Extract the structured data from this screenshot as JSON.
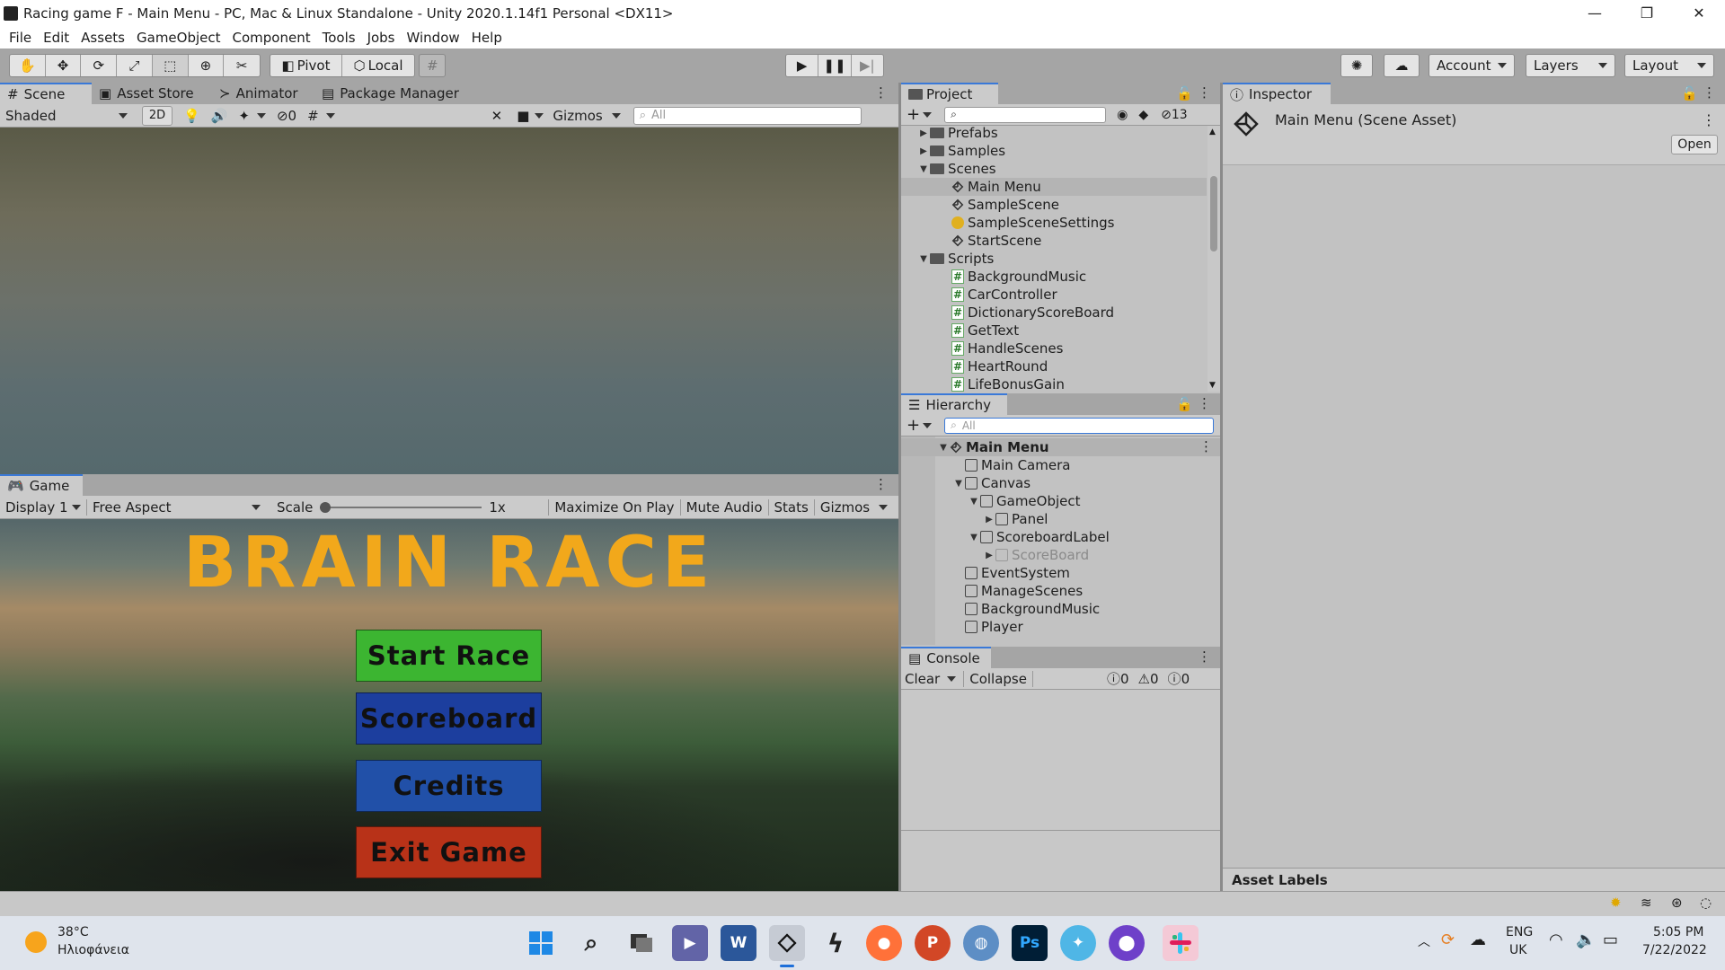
{
  "window": {
    "title": "Racing game F - Main Menu - PC, Mac & Linux Standalone - Unity 2020.1.14f1 Personal <DX11>",
    "controls": [
      "—",
      "❐",
      "✕"
    ]
  },
  "menubar": [
    "File",
    "Edit",
    "Assets",
    "GameObject",
    "Component",
    "Tools",
    "Jobs",
    "Window",
    "Help"
  ],
  "toolbar": {
    "pivot": "Pivot",
    "local": "Local",
    "account": "Account",
    "layers": "Layers",
    "layout": "Layout"
  },
  "scene_panel": {
    "tabs": [
      "Scene",
      "Asset Store",
      "Animator",
      "Package Manager"
    ],
    "shading": "Shaded",
    "mode_2d": "2D",
    "hidden_count": "0",
    "gizmos": "Gizmos",
    "search_placeholder": "All"
  },
  "game_panel": {
    "tab": "Game",
    "display": "Display 1",
    "aspect": "Free Aspect",
    "scale_label": "Scale",
    "scale_value": "1x",
    "buttons": [
      "Maximize On Play",
      "Mute Audio",
      "Stats",
      "Gizmos"
    ],
    "game_title": "BRAIN RACE",
    "menu": [
      {
        "label": "Start Race",
        "color": "#3cb531"
      },
      {
        "label": "Scoreboard",
        "color": "#1c3e9e"
      },
      {
        "label": "Credits",
        "color": "#2150a8"
      },
      {
        "label": "Exit Game",
        "color": "#b83218"
      }
    ]
  },
  "project": {
    "tab": "Project",
    "hidden_count": "13",
    "items": [
      {
        "label": "Prefabs",
        "type": "folder",
        "depth": 0,
        "fold": "▶"
      },
      {
        "label": "Samples",
        "type": "folder",
        "depth": 0,
        "fold": "▶"
      },
      {
        "label": "Scenes",
        "type": "folder",
        "depth": 0,
        "fold": "▼"
      },
      {
        "label": "Main Menu",
        "type": "scene",
        "depth": 1,
        "selected": true
      },
      {
        "label": "SampleScene",
        "type": "scene",
        "depth": 1
      },
      {
        "label": "SampleSceneSettings",
        "type": "settings",
        "depth": 1
      },
      {
        "label": "StartScene",
        "type": "scene",
        "depth": 1
      },
      {
        "label": "Scripts",
        "type": "folder",
        "depth": 0,
        "fold": "▼"
      },
      {
        "label": "BackgroundMusic",
        "type": "script",
        "depth": 1
      },
      {
        "label": "CarController",
        "type": "script",
        "depth": 1
      },
      {
        "label": "DictionaryScoreBoard",
        "type": "script",
        "depth": 1
      },
      {
        "label": "GetText",
        "type": "script",
        "depth": 1
      },
      {
        "label": "HandleScenes",
        "type": "script",
        "depth": 1
      },
      {
        "label": "HeartRound",
        "type": "script",
        "depth": 1
      },
      {
        "label": "LifeBonusGain",
        "type": "script",
        "depth": 1
      }
    ]
  },
  "hierarchy": {
    "tab": "Hierarchy",
    "search_placeholder": "All",
    "items": [
      {
        "label": "Main Menu",
        "type": "scene",
        "depth": 0,
        "fold": "▼",
        "bold": true
      },
      {
        "label": "Main Camera",
        "type": "go",
        "depth": 1
      },
      {
        "label": "Canvas",
        "type": "go",
        "depth": 1,
        "fold": "▼"
      },
      {
        "label": "GameObject",
        "type": "go",
        "depth": 2,
        "fold": "▼"
      },
      {
        "label": "Panel",
        "type": "go",
        "depth": 3,
        "fold": "▶"
      },
      {
        "label": "ScoreboardLabel",
        "type": "go",
        "depth": 2,
        "fold": "▼"
      },
      {
        "label": "ScoreBoard",
        "type": "go",
        "depth": 3,
        "fold": "▶",
        "disabled": true
      },
      {
        "label": "EventSystem",
        "type": "go",
        "depth": 1
      },
      {
        "label": "ManageScenes",
        "type": "go",
        "depth": 1
      },
      {
        "label": "BackgroundMusic",
        "type": "go",
        "depth": 1
      },
      {
        "label": "Player",
        "type": "go",
        "depth": 1
      }
    ]
  },
  "console": {
    "tab": "Console",
    "clear": "Clear",
    "collapse": "Collapse",
    "errors": "0",
    "warnings": "0",
    "logs": "0"
  },
  "inspector": {
    "tab": "Inspector",
    "title": "Main Menu (Scene Asset)",
    "open": "Open",
    "asset_labels": "Asset Labels"
  },
  "taskbar": {
    "temperature": "38°C",
    "weather": "Ηλιοφάνεια",
    "lang1": "ENG",
    "lang2": "UK",
    "time": "5:05 PM",
    "date": "7/22/2022"
  }
}
